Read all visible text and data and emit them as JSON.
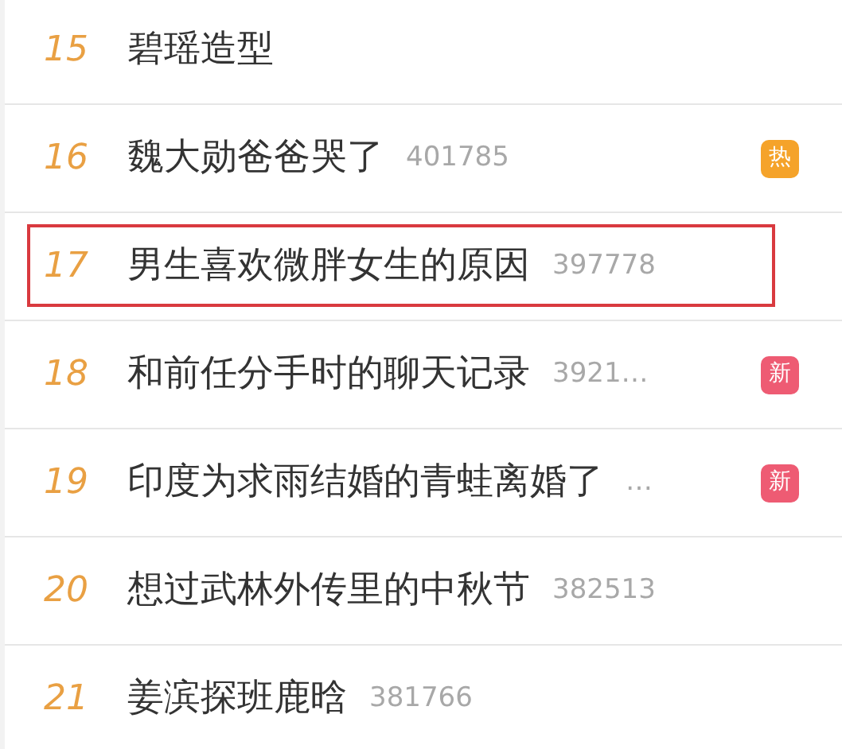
{
  "rows": [
    {
      "rank": "15",
      "title": "碧瑶造型",
      "highlighted": false
    },
    {
      "rank": "16",
      "title": "魏大勋爸爸哭了",
      "count": "401785",
      "badge": {
        "kind": "hot",
        "label": "热"
      },
      "highlighted": false
    },
    {
      "rank": "17",
      "title": "男生喜欢微胖女生的原因",
      "count": "397778",
      "highlighted": true
    },
    {
      "rank": "18",
      "title": "和前任分手时的聊天记录",
      "count": "3921…",
      "badge": {
        "kind": "new",
        "label": "新"
      },
      "highlighted": false
    },
    {
      "rank": "19",
      "title": "印度为求雨结婚的青蛙离婚了",
      "count": "…",
      "badge": {
        "kind": "new",
        "label": "新"
      },
      "highlighted": false
    },
    {
      "rank": "20",
      "title": "想过武林外传里的中秋节",
      "count": "382513",
      "highlighted": false
    },
    {
      "rank": "21",
      "title": "姜滨探班鹿晗",
      "count": "381766",
      "highlighted": false
    }
  ]
}
